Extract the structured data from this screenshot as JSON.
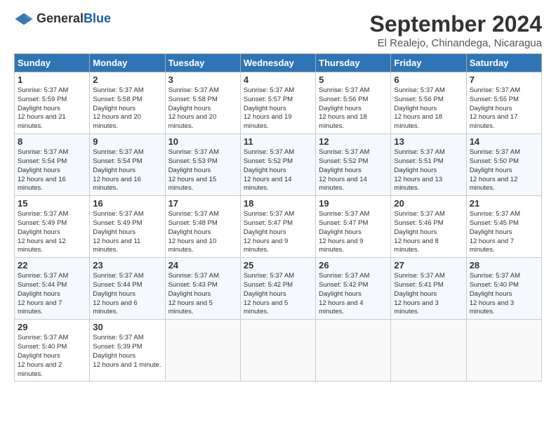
{
  "header": {
    "logo_general": "General",
    "logo_blue": "Blue",
    "month_title": "September 2024",
    "location": "El Realejo, Chinandega, Nicaragua"
  },
  "columns": [
    "Sunday",
    "Monday",
    "Tuesday",
    "Wednesday",
    "Thursday",
    "Friday",
    "Saturday"
  ],
  "weeks": [
    [
      {
        "day": "1",
        "sunrise": "5:37 AM",
        "sunset": "5:59 PM",
        "daylight": "12 hours and 21 minutes."
      },
      {
        "day": "2",
        "sunrise": "5:37 AM",
        "sunset": "5:58 PM",
        "daylight": "12 hours and 20 minutes."
      },
      {
        "day": "3",
        "sunrise": "5:37 AM",
        "sunset": "5:58 PM",
        "daylight": "12 hours and 20 minutes."
      },
      {
        "day": "4",
        "sunrise": "5:37 AM",
        "sunset": "5:57 PM",
        "daylight": "12 hours and 19 minutes."
      },
      {
        "day": "5",
        "sunrise": "5:37 AM",
        "sunset": "5:56 PM",
        "daylight": "12 hours and 18 minutes."
      },
      {
        "day": "6",
        "sunrise": "5:37 AM",
        "sunset": "5:56 PM",
        "daylight": "12 hours and 18 minutes."
      },
      {
        "day": "7",
        "sunrise": "5:37 AM",
        "sunset": "5:55 PM",
        "daylight": "12 hours and 17 minutes."
      }
    ],
    [
      {
        "day": "8",
        "sunrise": "5:37 AM",
        "sunset": "5:54 PM",
        "daylight": "12 hours and 16 minutes."
      },
      {
        "day": "9",
        "sunrise": "5:37 AM",
        "sunset": "5:54 PM",
        "daylight": "12 hours and 16 minutes."
      },
      {
        "day": "10",
        "sunrise": "5:37 AM",
        "sunset": "5:53 PM",
        "daylight": "12 hours and 15 minutes."
      },
      {
        "day": "11",
        "sunrise": "5:37 AM",
        "sunset": "5:52 PM",
        "daylight": "12 hours and 14 minutes."
      },
      {
        "day": "12",
        "sunrise": "5:37 AM",
        "sunset": "5:52 PM",
        "daylight": "12 hours and 14 minutes."
      },
      {
        "day": "13",
        "sunrise": "5:37 AM",
        "sunset": "5:51 PM",
        "daylight": "12 hours and 13 minutes."
      },
      {
        "day": "14",
        "sunrise": "5:37 AM",
        "sunset": "5:50 PM",
        "daylight": "12 hours and 12 minutes."
      }
    ],
    [
      {
        "day": "15",
        "sunrise": "5:37 AM",
        "sunset": "5:49 PM",
        "daylight": "12 hours and 12 minutes."
      },
      {
        "day": "16",
        "sunrise": "5:37 AM",
        "sunset": "5:49 PM",
        "daylight": "12 hours and 11 minutes."
      },
      {
        "day": "17",
        "sunrise": "5:37 AM",
        "sunset": "5:48 PM",
        "daylight": "12 hours and 10 minutes."
      },
      {
        "day": "18",
        "sunrise": "5:37 AM",
        "sunset": "5:47 PM",
        "daylight": "12 hours and 9 minutes."
      },
      {
        "day": "19",
        "sunrise": "5:37 AM",
        "sunset": "5:47 PM",
        "daylight": "12 hours and 9 minutes."
      },
      {
        "day": "20",
        "sunrise": "5:37 AM",
        "sunset": "5:46 PM",
        "daylight": "12 hours and 8 minutes."
      },
      {
        "day": "21",
        "sunrise": "5:37 AM",
        "sunset": "5:45 PM",
        "daylight": "12 hours and 7 minutes."
      }
    ],
    [
      {
        "day": "22",
        "sunrise": "5:37 AM",
        "sunset": "5:44 PM",
        "daylight": "12 hours and 7 minutes."
      },
      {
        "day": "23",
        "sunrise": "5:37 AM",
        "sunset": "5:44 PM",
        "daylight": "12 hours and 6 minutes."
      },
      {
        "day": "24",
        "sunrise": "5:37 AM",
        "sunset": "5:43 PM",
        "daylight": "12 hours and 5 minutes."
      },
      {
        "day": "25",
        "sunrise": "5:37 AM",
        "sunset": "5:42 PM",
        "daylight": "12 hours and 5 minutes."
      },
      {
        "day": "26",
        "sunrise": "5:37 AM",
        "sunset": "5:42 PM",
        "daylight": "12 hours and 4 minutes."
      },
      {
        "day": "27",
        "sunrise": "5:37 AM",
        "sunset": "5:41 PM",
        "daylight": "12 hours and 3 minutes."
      },
      {
        "day": "28",
        "sunrise": "5:37 AM",
        "sunset": "5:40 PM",
        "daylight": "12 hours and 3 minutes."
      }
    ],
    [
      {
        "day": "29",
        "sunrise": "5:37 AM",
        "sunset": "5:40 PM",
        "daylight": "12 hours and 2 minutes."
      },
      {
        "day": "30",
        "sunrise": "5:37 AM",
        "sunset": "5:39 PM",
        "daylight": "12 hours and 1 minute."
      },
      null,
      null,
      null,
      null,
      null
    ]
  ]
}
